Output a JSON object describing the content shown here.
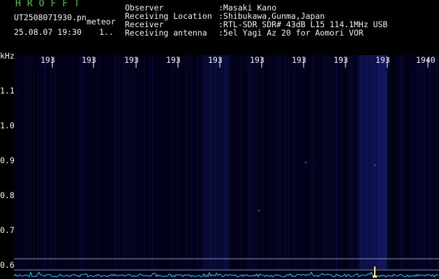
{
  "header": {
    "brand": "HROFFT",
    "filename": "UT2508071930.pn",
    "mode": "meteor",
    "datetime": "25.08.07 19:30",
    "count": "1..",
    "fields": [
      {
        "label": "Observer",
        "value": ":Masaki Kano"
      },
      {
        "label": "Receiving Location",
        "value": ":Shibukawa,Gunma,Japan"
      },
      {
        "label": "Receiver",
        "value": ":RTL-SDR SDR# 43dB L15 114.1MHz USB"
      },
      {
        "label": "Receiving antenna",
        "value": ":5el Yagi Az 20 for Aomori VOR"
      }
    ]
  },
  "axes": {
    "y_unit": "kHz",
    "y_ticks": [
      "1.1",
      "1.0",
      "0.9",
      "0.8",
      "0.7",
      "0.6"
    ],
    "x_ticks": [
      "193",
      "193",
      "193",
      "193",
      "193",
      "193",
      "193",
      "193",
      "193",
      "1940"
    ]
  },
  "colors": {
    "background": "#000014",
    "text": "#f2f2f2",
    "brand": "#37d23a",
    "spectrum": "#1ec8ff",
    "meteor": "#ffff40"
  }
}
